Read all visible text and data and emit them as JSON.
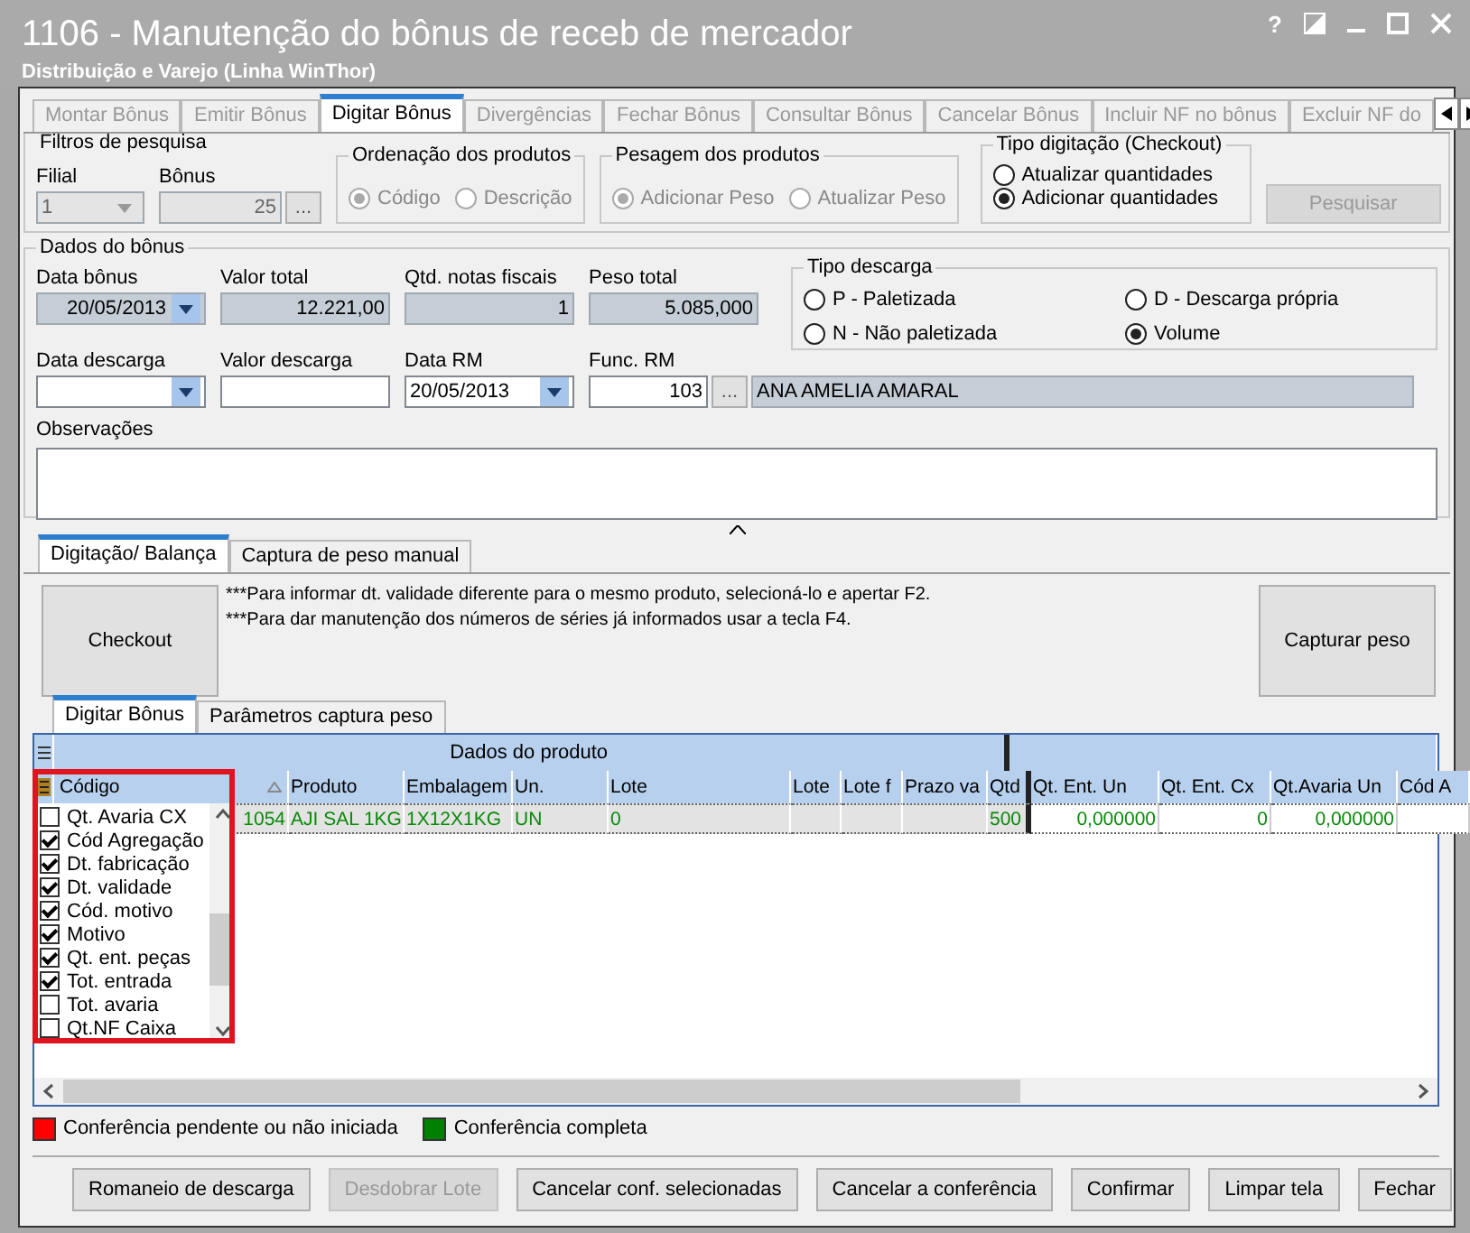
{
  "window": {
    "title": "1106 - Manutenção do bônus de receb de mercador",
    "subtitle": "Distribuição e Varejo (Linha WinThor)",
    "help": "?"
  },
  "tabs": [
    {
      "label": "Montar Bônus",
      "selected": false
    },
    {
      "label": "Emitir Bônus",
      "selected": false
    },
    {
      "label": "Digitar Bônus",
      "selected": true
    },
    {
      "label": "Divergências",
      "selected": false
    },
    {
      "label": "Fechar Bônus",
      "selected": false
    },
    {
      "label": "Consultar Bônus",
      "selected": false
    },
    {
      "label": "Cancelar Bônus",
      "selected": false
    },
    {
      "label": "Incluir NF no bônus",
      "selected": false
    },
    {
      "label": "Excluir NF do",
      "selected": false
    }
  ],
  "filters": {
    "title": "Filtros de pesquisa",
    "filial": {
      "label": "Filial",
      "value": "1",
      "disabled": true
    },
    "bonus": {
      "label": "Bônus",
      "value": "25",
      "disabled": true,
      "lookup": "..."
    },
    "groups": [
      {
        "title": "Ordenação dos produtos",
        "disabled": true,
        "options": [
          {
            "label": "Código",
            "selected": true
          },
          {
            "label": "Descrição",
            "selected": false
          }
        ]
      },
      {
        "title": "Pesagem dos produtos",
        "disabled": true,
        "options": [
          {
            "label": "Adicionar Peso",
            "selected": true
          },
          {
            "label": "Atualizar Peso",
            "selected": false
          }
        ]
      },
      {
        "title": "Tipo digitação (Checkout)",
        "disabled": false,
        "options": [
          {
            "label": "Atualizar quantidades",
            "selected": false
          },
          {
            "label": "Adicionar quantidades",
            "selected": true
          }
        ]
      }
    ],
    "search_button": {
      "label": "Pesquisar",
      "disabled": true
    }
  },
  "bonus_data": {
    "title": "Dados do bônus",
    "row1": [
      {
        "label": "Data bônus",
        "value": "20/05/2013",
        "kind": "combo",
        "disabled": true
      },
      {
        "label": "Valor total",
        "value": "12.221,00",
        "kind": "text",
        "disabled": true
      },
      {
        "label": "Qtd. notas fiscais",
        "value": "1",
        "kind": "text",
        "disabled": true
      },
      {
        "label": "Peso total",
        "value": "5.085,000",
        "kind": "text",
        "disabled": true
      }
    ],
    "row2": [
      {
        "label": "Data descarga",
        "kind": "combo",
        "disabled": false
      },
      {
        "label": "Valor descarga",
        "kind": "text",
        "disabled": false
      },
      {
        "label": "Data RM",
        "value": "20/05/2013",
        "kind": "combo",
        "disabled": false
      },
      {
        "label": "Func. RM",
        "value": "103",
        "kind": "lookup",
        "disabled": false,
        "lookup": "...",
        "name": "ANA AMELIA AMARAL"
      }
    ],
    "unload_type": {
      "title": "Tipo descarga",
      "options": [
        {
          "label": "P - Paletizada",
          "selected": false
        },
        {
          "label": "D - Descarga própria",
          "selected": false
        },
        {
          "label": "N - Não paletizada",
          "selected": false
        },
        {
          "label": "Volume",
          "selected": true
        }
      ]
    },
    "notes_label": "Observações"
  },
  "lower_tabs": [
    {
      "label": "Digitação/ Balança",
      "selected": true
    },
    {
      "label": "Captura de peso manual",
      "selected": false
    }
  ],
  "checkout_button": "Checkout",
  "hints": [
    "***Para informar dt. validade diferente para o mesmo produto, selecioná-lo e apertar F2.",
    "***Para dar manutenção dos números de séries já informados  usar a tecla F4."
  ],
  "capture_button": "Capturar peso",
  "inner_tabs": [
    {
      "label": "Digitar Bônus",
      "selected": true
    },
    {
      "label": "Parâmetros captura peso",
      "selected": false
    }
  ],
  "grid": {
    "bands": [
      {
        "label": "Dados do produto",
        "columns": [
          {
            "label": "Código",
            "sorted": true
          },
          {
            "label": "Produto"
          },
          {
            "label": "Embalagem"
          },
          {
            "label": "Un."
          },
          {
            "label": "Lote"
          },
          {
            "label": "Lote"
          },
          {
            "label": "Lote f"
          },
          {
            "label": "Prazo va"
          },
          {
            "label": "Qtd"
          }
        ]
      },
      {
        "columns": [
          {
            "label": "Qt. Ent. Un"
          },
          {
            "label": "Qt. Ent. Cx"
          },
          {
            "label": "Qt.Avaria Un"
          },
          {
            "label": "Cód A"
          }
        ]
      }
    ],
    "rows": [
      {
        "cells": [
          "1054",
          "AJI SAL 1KG",
          "1X12X1KG",
          "UN",
          "0",
          null,
          null,
          null,
          "500",
          "0,000000",
          "0",
          "0,000000",
          null
        ]
      }
    ]
  },
  "column_chooser": {
    "highlighted": true,
    "items": [
      {
        "label": "Qt. Avaria CX",
        "checked": false
      },
      {
        "label": "Cód Agregação",
        "checked": true
      },
      {
        "label": "Dt. fabricação",
        "checked": true
      },
      {
        "label": "Dt. validade",
        "checked": true
      },
      {
        "label": "Cód. motivo",
        "checked": true
      },
      {
        "label": "Motivo",
        "checked": true
      },
      {
        "label": "Qt. ent. peças",
        "checked": true
      },
      {
        "label": "Tot. entrada",
        "checked": true
      },
      {
        "label": "Tot. avaria",
        "checked": false
      },
      {
        "label": "Qt.NF Caixa",
        "checked": false
      }
    ]
  },
  "legend": [
    {
      "label": "Conferência pendente ou não iniciada",
      "color": "#ff0000"
    },
    {
      "label": "Conferência completa",
      "color": "#008000"
    }
  ],
  "buttons": [
    {
      "label": "Romaneio de descarga",
      "disabled": false
    },
    {
      "label": "Desdobrar Lote",
      "disabled": true
    },
    {
      "label": "Cancelar conf. selecionadas",
      "disabled": false
    },
    {
      "label": "Cancelar a conferência",
      "disabled": false
    },
    {
      "label": "Confirmar",
      "disabled": false
    },
    {
      "label": "Limpar tela",
      "disabled": false
    },
    {
      "label": "Fechar",
      "disabled": false
    }
  ]
}
